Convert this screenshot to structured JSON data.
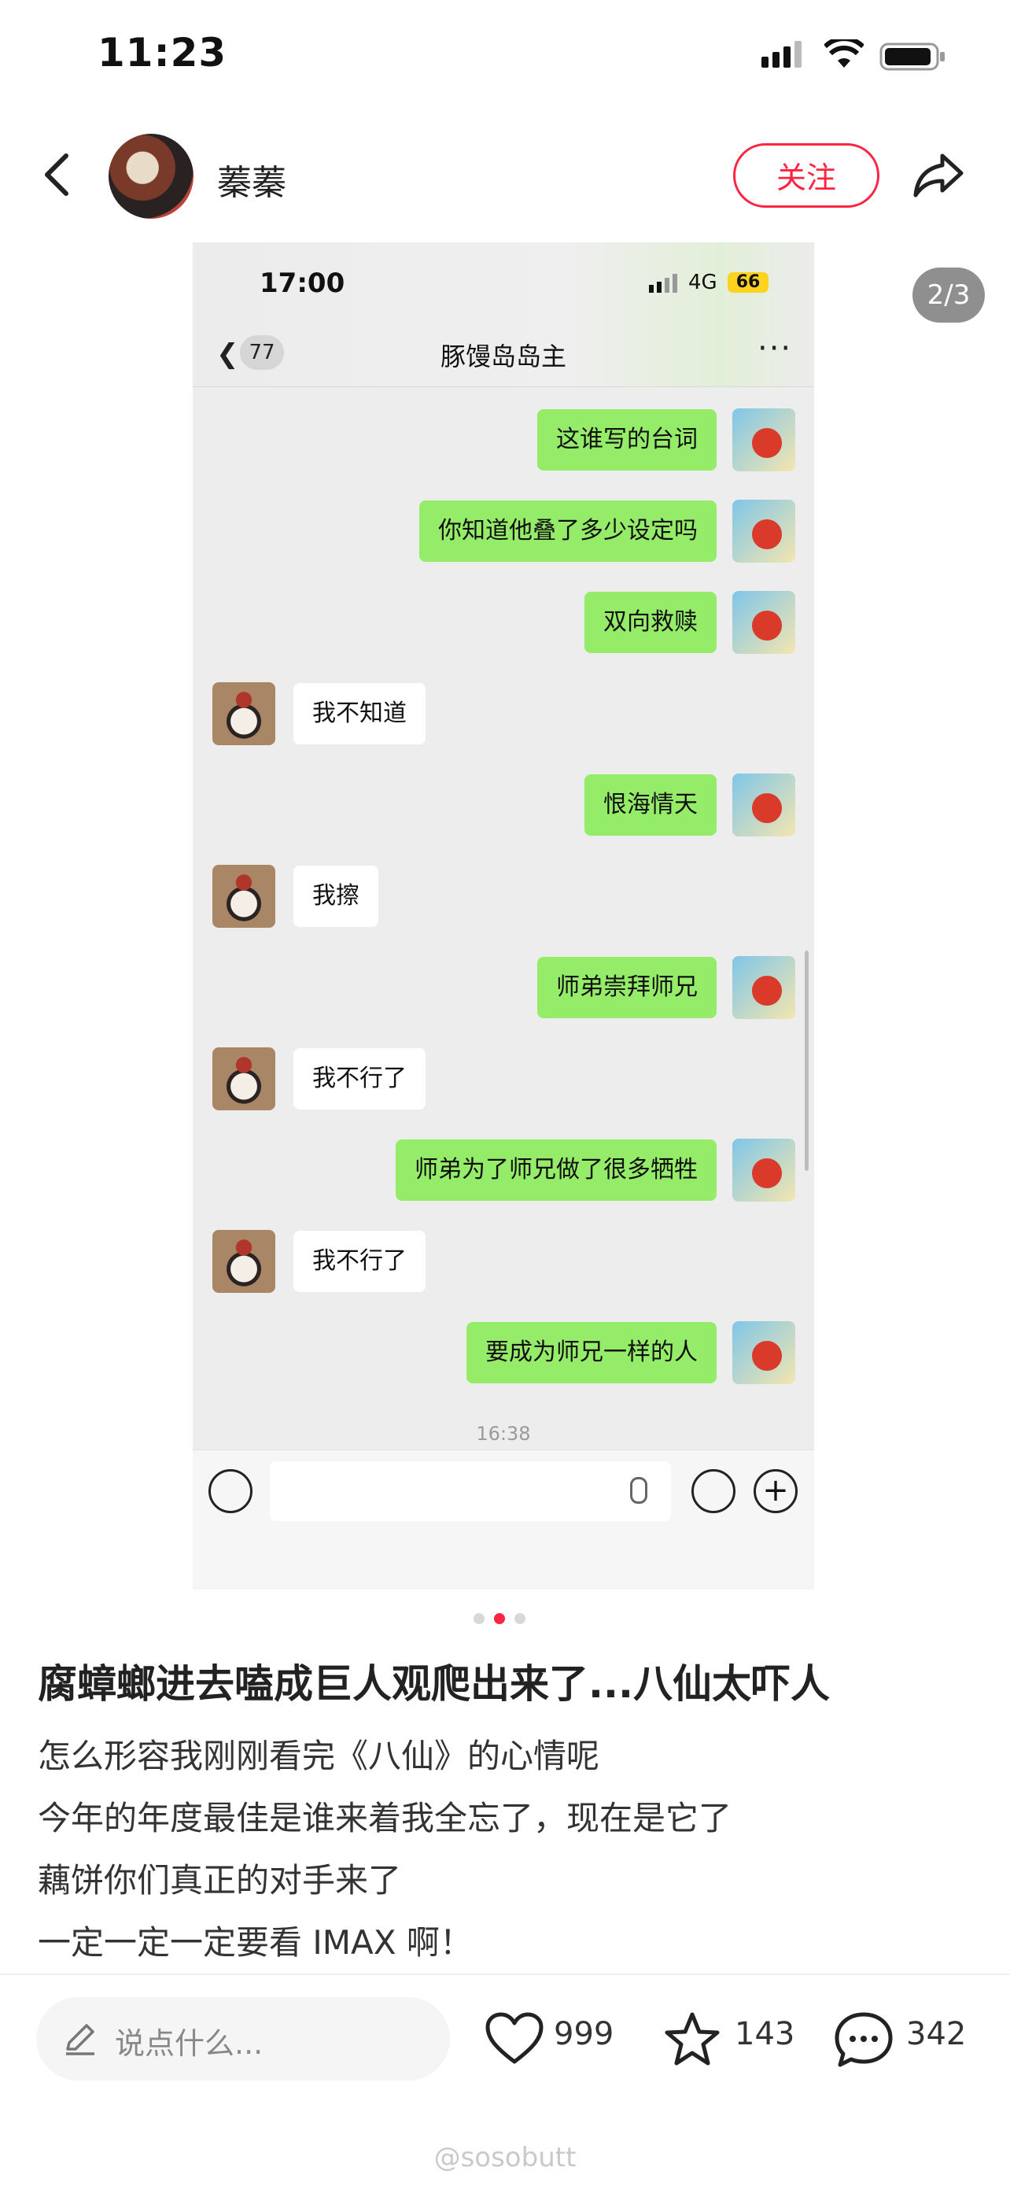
{
  "status_bar": {
    "time": "11:23"
  },
  "header": {
    "username": "蓁蓁",
    "follow_label": "关注"
  },
  "page_indicator": "2/3",
  "screenshot": {
    "status_time": "17:00",
    "network": "4G",
    "battery": "66",
    "unread_count": "77",
    "chat_title": "豚馒岛岛主",
    "more": "···",
    "timestamp": "16:38",
    "messages": [
      {
        "side": "right",
        "text": "这谁写的台词"
      },
      {
        "side": "right",
        "text": "你知道他叠了多少设定吗"
      },
      {
        "side": "right",
        "text": "双向救赎"
      },
      {
        "side": "left",
        "text": "我不知道"
      },
      {
        "side": "right",
        "text": "恨海情天"
      },
      {
        "side": "left",
        "text": "我擦"
      },
      {
        "side": "right",
        "text": "师弟崇拜师兄"
      },
      {
        "side": "left",
        "text": "我不行了"
      },
      {
        "side": "right",
        "text": "师弟为了师兄做了很多牺牲"
      },
      {
        "side": "left",
        "text": "我不行了"
      },
      {
        "side": "right",
        "text": "要成为师兄一样的人"
      }
    ]
  },
  "post": {
    "title": "腐蟑螂进去嗑成巨人观爬出来了...八仙太吓人",
    "body": [
      "怎么形容我刚刚看完《八仙》的心情呢",
      "今年的年度最佳是谁来着我全忘了，现在是它了",
      "藕饼你们真正的对手来了",
      "一定一定一定要看 IMAX 啊！"
    ]
  },
  "bottom_bar": {
    "comment_placeholder": "说点什么...",
    "likes": "999",
    "collects": "143",
    "comments": "342"
  },
  "watermark": "@sosobutt",
  "colors": {
    "accent": "#ff2442",
    "bubble_green": "#95ec69"
  }
}
